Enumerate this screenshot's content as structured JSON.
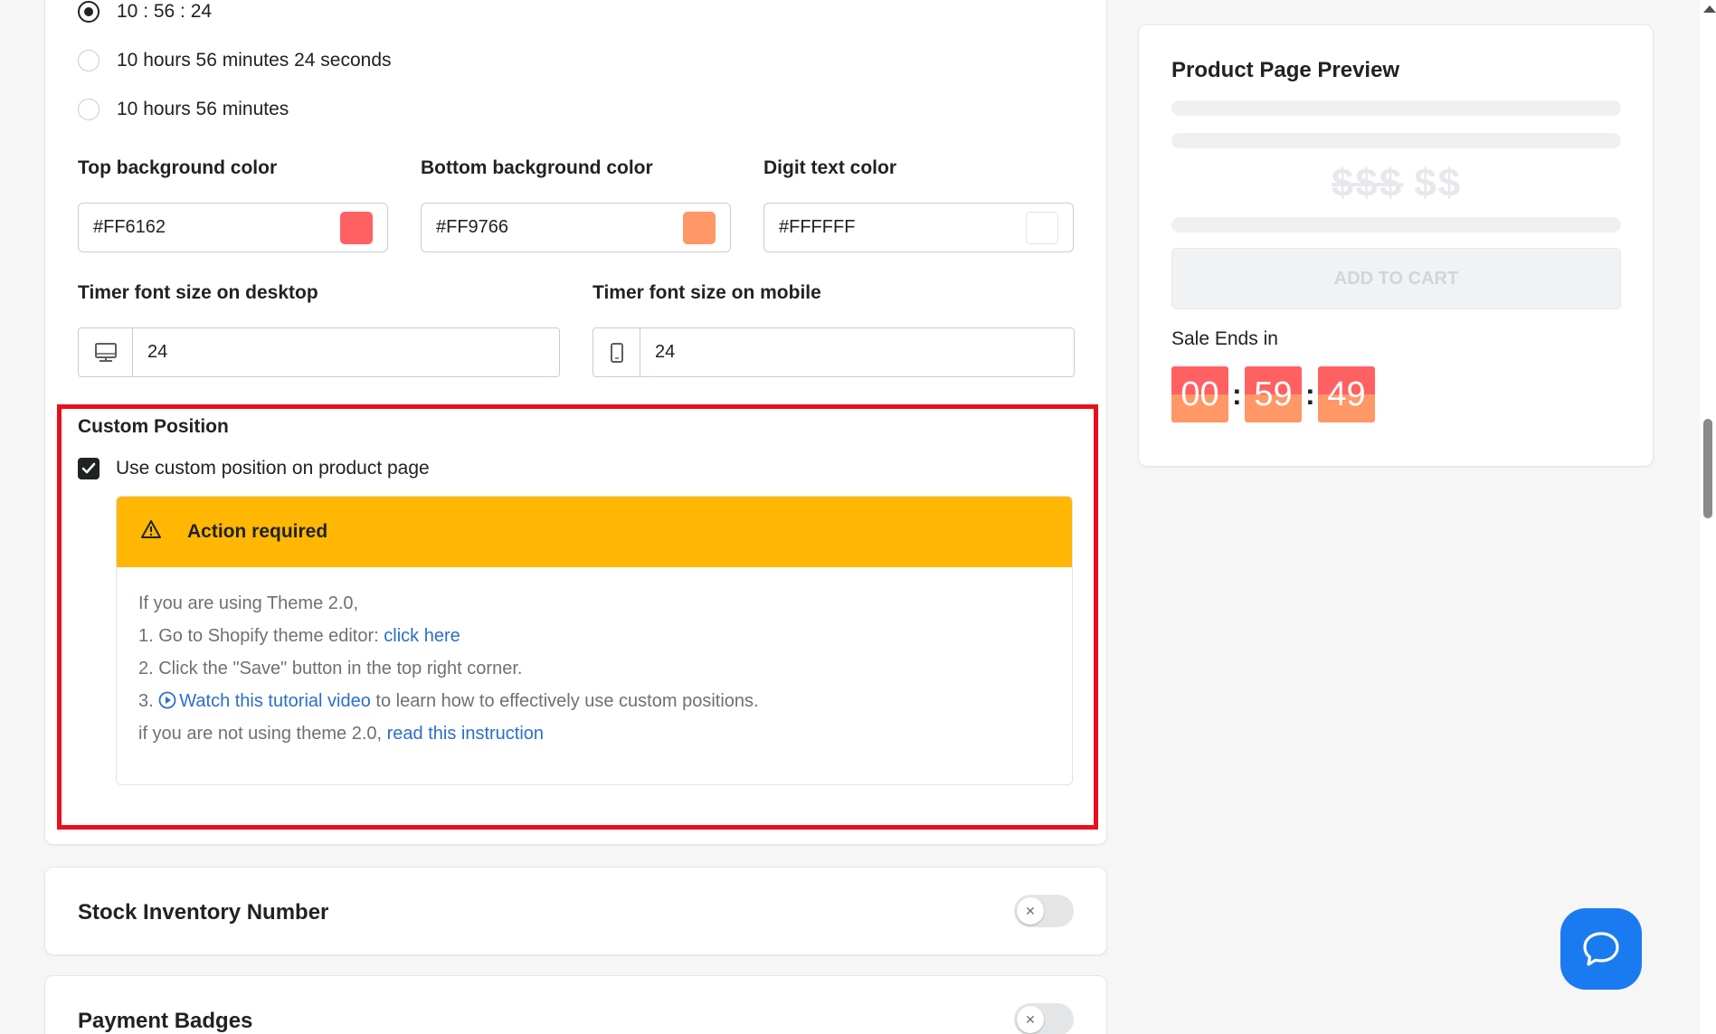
{
  "format": {
    "options": [
      {
        "label": "10 : 56 : 24",
        "checked": true
      },
      {
        "label": "10 hours 56 minutes 24 seconds",
        "checked": false
      },
      {
        "label": "10 hours 56 minutes",
        "checked": false
      }
    ]
  },
  "colors": {
    "top": {
      "label": "Top background color",
      "value": "#FF6162",
      "swatch": "#FF6162"
    },
    "bottom": {
      "label": "Bottom background color",
      "value": "#FF9766",
      "swatch": "#FF9766"
    },
    "digit": {
      "label": "Digit text color",
      "value": "#FFFFFF",
      "swatch": "#FFFFFF"
    }
  },
  "font_size": {
    "desktop": {
      "label": "Timer font size on desktop",
      "value": "24",
      "icon": "desktop-icon"
    },
    "mobile": {
      "label": "Timer font size on mobile",
      "value": "24",
      "icon": "mobile-icon"
    }
  },
  "custom_position": {
    "title": "Custom Position",
    "checkbox_label": "Use custom position on product page",
    "checked": true,
    "banner": {
      "title": "Action required",
      "icon": "warning-icon",
      "intro": "If you are using Theme 2.0,",
      "step1_text": "1. Go to Shopify theme editor: ",
      "step1_link": "click here",
      "step2_text": "2. Click the \"Save\" button in the top right corner.",
      "step3_prefix": "3. ",
      "step3_link": "Watch this tutorial video",
      "step3_suffix": " to learn how to effectively use custom positions.",
      "footer_text": "if you are not using theme 2.0, ",
      "footer_link": "read this instruction"
    }
  },
  "sections": [
    {
      "title": "Stock Inventory Number",
      "enabled": false
    },
    {
      "title": "Payment Badges",
      "enabled": false
    }
  ],
  "preview": {
    "title": "Product Page Preview",
    "price_old": "$$$",
    "price_new": "$$",
    "add_to_cart": "ADD TO CART",
    "sale_label": "Sale Ends in",
    "timer": {
      "hours": "00",
      "minutes": "59",
      "seconds": "49",
      "separator": ":"
    }
  },
  "accent_colors": {
    "highlight": "#e8101d",
    "banner": "#ffb703",
    "link": "#2c6ecb",
    "chat": "#1a7bf0"
  }
}
